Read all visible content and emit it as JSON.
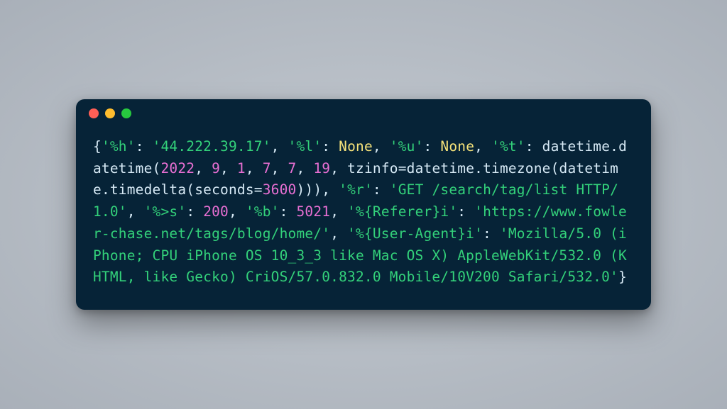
{
  "window": {
    "traffic_lights": [
      "close",
      "minimize",
      "zoom"
    ]
  },
  "colors": {
    "string": "#33d17a",
    "none": "#f5e27a",
    "number": "#e86fd3",
    "ident": "#d6e9f5",
    "bg": "#062337"
  },
  "log_entry": {
    "%h": "44.222.39.17",
    "%l": null,
    "%u": null,
    "%t": {
      "repr": "datetime.datetime(2022, 9, 1, 7, 7, 19, tzinfo=datetime.timezone(datetime.timedelta(seconds=3600)))",
      "year": 2022,
      "month": 9,
      "day": 1,
      "hour": 7,
      "minute": 7,
      "second": 19,
      "tz_offset_seconds": 3600
    },
    "%r": "GET /search/tag/list HTTP/1.0",
    "%>s": 200,
    "%b": 5021,
    "%{Referer}i": "https://www.fowler-chase.net/tags/blog/home/",
    "%{User-Agent}i": "Mozilla/5.0 (iPhone; CPU iPhone OS 10_3_3 like Mac OS X) AppleWebKit/532.0 (KHTML, like Gecko) CriOS/57.0.832.0 Mobile/10V200 Safari/532.0"
  },
  "tokens": [
    {
      "cls": "k-brace",
      "t": "{"
    },
    {
      "cls": "k-str",
      "key": "%h",
      "q": true
    },
    {
      "cls": "k-punct",
      "t": ": "
    },
    {
      "cls": "k-str",
      "bind": "log_entry.%h",
      "q": true
    },
    {
      "cls": "k-punct",
      "t": ", "
    },
    {
      "cls": "k-str",
      "key": "%l",
      "q": true
    },
    {
      "cls": "k-punct",
      "t": ": "
    },
    {
      "cls": "k-none",
      "t": "None"
    },
    {
      "cls": "k-punct",
      "t": ", "
    },
    {
      "cls": "k-str",
      "key": "%u",
      "q": true
    },
    {
      "cls": "k-punct",
      "t": ": "
    },
    {
      "cls": "k-none",
      "t": "None"
    },
    {
      "cls": "k-punct",
      "t": ", "
    },
    {
      "cls": "k-str",
      "key": "%t",
      "q": true
    },
    {
      "cls": "k-punct",
      "t": ": "
    },
    {
      "cls": "k-ident",
      "t": "datetime"
    },
    {
      "cls": "k-punct",
      "t": "."
    },
    {
      "cls": "k-ident",
      "t": "datetime"
    },
    {
      "cls": "k-punct",
      "t": "("
    },
    {
      "cls": "k-num",
      "bind": "log_entry.%t.year"
    },
    {
      "cls": "k-punct",
      "t": ", "
    },
    {
      "cls": "k-num",
      "bind": "log_entry.%t.month"
    },
    {
      "cls": "k-punct",
      "t": ", "
    },
    {
      "cls": "k-num",
      "bind": "log_entry.%t.day"
    },
    {
      "cls": "k-punct",
      "t": ", "
    },
    {
      "cls": "k-num",
      "bind": "log_entry.%t.hour"
    },
    {
      "cls": "k-punct",
      "t": ", "
    },
    {
      "cls": "k-num",
      "bind": "log_entry.%t.minute"
    },
    {
      "cls": "k-punct",
      "t": ", "
    },
    {
      "cls": "k-num",
      "bind": "log_entry.%t.second"
    },
    {
      "cls": "k-punct",
      "t": ", "
    },
    {
      "cls": "k-ident",
      "t": "tzinfo"
    },
    {
      "cls": "k-punct",
      "t": "="
    },
    {
      "cls": "k-ident",
      "t": "datetime"
    },
    {
      "cls": "k-punct",
      "t": "."
    },
    {
      "cls": "k-ident",
      "t": "timezone"
    },
    {
      "cls": "k-punct",
      "t": "("
    },
    {
      "cls": "k-ident",
      "t": "datetime"
    },
    {
      "cls": "k-punct",
      "t": "."
    },
    {
      "cls": "k-ident",
      "t": "timedelta"
    },
    {
      "cls": "k-punct",
      "t": "("
    },
    {
      "cls": "k-ident",
      "t": "seconds"
    },
    {
      "cls": "k-punct",
      "t": "="
    },
    {
      "cls": "k-num",
      "bind": "log_entry.%t.tz_offset_seconds"
    },
    {
      "cls": "k-punct",
      "t": ")))"
    },
    {
      "cls": "k-punct",
      "t": ", "
    },
    {
      "cls": "k-str",
      "key": "%r",
      "q": true
    },
    {
      "cls": "k-punct",
      "t": ": "
    },
    {
      "cls": "k-str",
      "bind": "log_entry.%r",
      "q": true
    },
    {
      "cls": "k-punct",
      "t": ", "
    },
    {
      "cls": "k-str",
      "key": "%>s",
      "q": true
    },
    {
      "cls": "k-punct",
      "t": ": "
    },
    {
      "cls": "k-num",
      "bind": "log_entry.%>s"
    },
    {
      "cls": "k-punct",
      "t": ", "
    },
    {
      "cls": "k-str",
      "key": "%b",
      "q": true
    },
    {
      "cls": "k-punct",
      "t": ": "
    },
    {
      "cls": "k-num",
      "bind": "log_entry.%b"
    },
    {
      "cls": "k-punct",
      "t": ", "
    },
    {
      "cls": "k-str",
      "key": "%{Referer}i",
      "q": true
    },
    {
      "cls": "k-punct",
      "t": ": "
    },
    {
      "cls": "k-str",
      "bind": "log_entry.%{Referer}i",
      "q": true
    },
    {
      "cls": "k-punct",
      "t": ", "
    },
    {
      "cls": "k-str",
      "key": "%{User-Agent}i",
      "q": true
    },
    {
      "cls": "k-punct",
      "t": ": "
    },
    {
      "cls": "k-str",
      "bind": "log_entry.%{User-Agent}i",
      "q": true
    },
    {
      "cls": "k-brace",
      "t": "}"
    }
  ]
}
